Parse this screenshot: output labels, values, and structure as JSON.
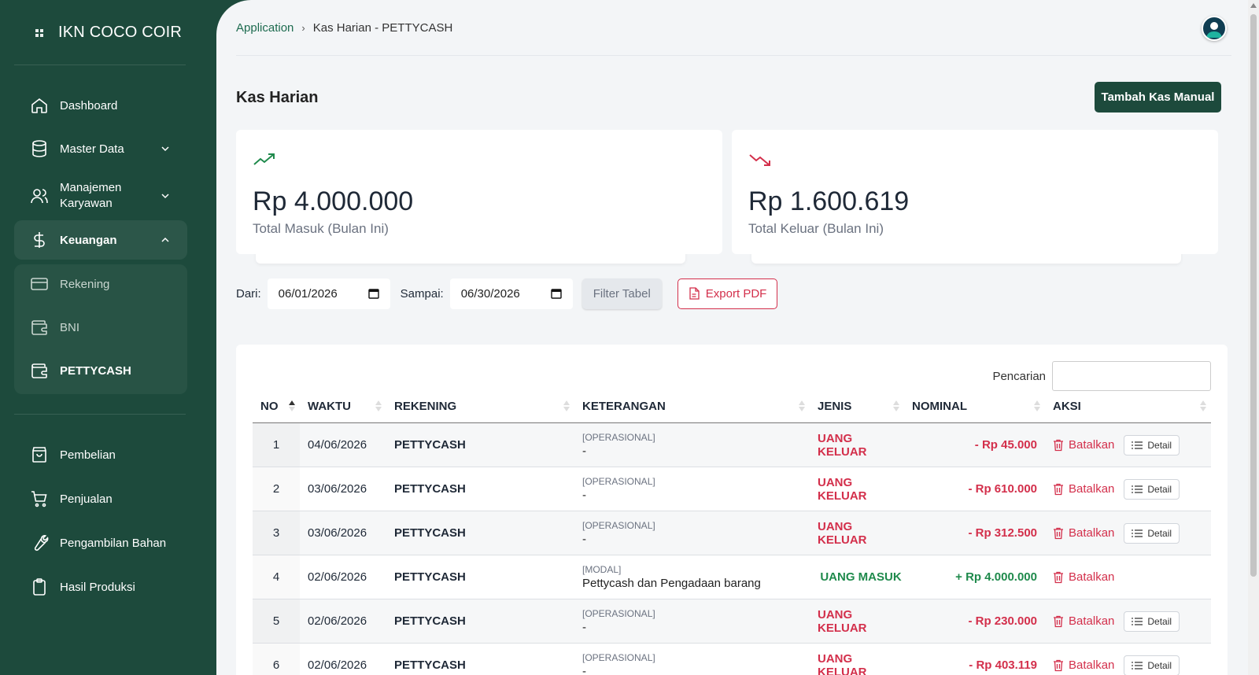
{
  "brand": {
    "name": "IKN COCO COIR"
  },
  "sidebar": {
    "items": [
      {
        "label": "Dashboard",
        "icon": "home-icon"
      },
      {
        "label": "Master Data",
        "icon": "database-icon"
      },
      {
        "label": "Manajemen Karyawan",
        "icon": "users-icon"
      },
      {
        "label": "Keuangan",
        "icon": "dollar-icon"
      },
      {
        "label": "Pembelian",
        "icon": "shopping-bag-icon"
      },
      {
        "label": "Penjualan",
        "icon": "cart-icon"
      },
      {
        "label": "Pengambilan Bahan",
        "icon": "wrench-icon"
      },
      {
        "label": "Hasil Produksi",
        "icon": "clipboard-icon"
      }
    ],
    "keuangan_sub": [
      {
        "label": "Rekening",
        "icon": "card-icon"
      },
      {
        "label": "BNI",
        "icon": "wallet-icon"
      },
      {
        "label": "PETTYCASH",
        "icon": "wallet-icon"
      }
    ]
  },
  "breadcrumb": {
    "root": "Application",
    "current": "Kas Harian - PETTYCASH"
  },
  "page": {
    "title": "Kas Harian",
    "add_button": "Tambah Kas Manual"
  },
  "cards": {
    "income": {
      "amount": "Rp 4.000.000",
      "caption": "Total Masuk (Bulan Ini)"
    },
    "expense": {
      "amount": "Rp 1.600.619",
      "caption": "Total Keluar (Bulan Ini)"
    }
  },
  "filter": {
    "from_label": "Dari:",
    "from_value": "06/01/2026",
    "to_label": "Sampai:",
    "to_value": "06/30/2026",
    "filter_button": "Filter Tabel",
    "export_button": "Export PDF"
  },
  "table": {
    "search_label": "Pencarian",
    "headers": [
      "NO",
      "WAKTU",
      "REKENING",
      "KETERANGAN",
      "JENIS",
      "NOMINAL",
      "AKSI"
    ],
    "cancel_label": "Batalkan",
    "detail_label": "Detail",
    "rows": [
      {
        "no": "1",
        "waktu": "04/06/2026",
        "rekening": "PETTYCASH",
        "kategori": "[OPERASIONAL]",
        "keterangan": "-",
        "jenis": "UANG KELUAR",
        "nominal": "- Rp 45.000"
      },
      {
        "no": "2",
        "waktu": "03/06/2026",
        "rekening": "PETTYCASH",
        "kategori": "[OPERASIONAL]",
        "keterangan": "-",
        "jenis": "UANG KELUAR",
        "nominal": "- Rp 610.000"
      },
      {
        "no": "3",
        "waktu": "03/06/2026",
        "rekening": "PETTYCASH",
        "kategori": "[OPERASIONAL]",
        "keterangan": "-",
        "jenis": "UANG KELUAR",
        "nominal": "- Rp 312.500"
      },
      {
        "no": "4",
        "waktu": "02/06/2026",
        "rekening": "PETTYCASH",
        "kategori": "[MODAL]",
        "keterangan": "Pettycash dan Pengadaan barang",
        "jenis": "UANG MASUK",
        "nominal": "+ Rp 4.000.000"
      },
      {
        "no": "5",
        "waktu": "02/06/2026",
        "rekening": "PETTYCASH",
        "kategori": "[OPERASIONAL]",
        "keterangan": "-",
        "jenis": "UANG KELUAR",
        "nominal": "- Rp 230.000"
      },
      {
        "no": "6",
        "waktu": "02/06/2026",
        "rekening": "PETTYCASH",
        "kategori": "[OPERASIONAL]",
        "keterangan": "-",
        "jenis": "UANG KELUAR",
        "nominal": "- Rp 403.119"
      }
    ]
  },
  "colors": {
    "brand": "#1d4a3c",
    "danger": "#d32f4b",
    "success": "#1f8a4c"
  }
}
